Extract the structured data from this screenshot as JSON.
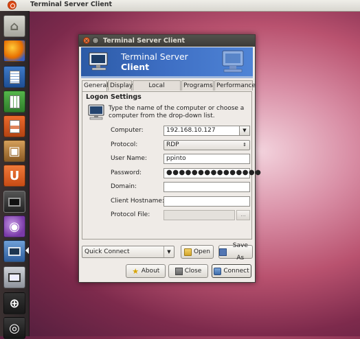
{
  "panel": {
    "title": "Terminal Server Client"
  },
  "launcher": {
    "items": [
      "home-folder",
      "firefox",
      "writer",
      "calc",
      "impress",
      "software-centre",
      "ubuntu-one",
      "terminal",
      "network",
      "terminal-server-client",
      "workspace-switcher",
      "magnifier",
      "eye"
    ]
  },
  "dialog": {
    "title": "Terminal Server Client",
    "banner_line1": "Terminal Server",
    "banner_line2": "Client",
    "tabs": [
      "General",
      "Display",
      "Local Resources",
      "Programs",
      "Performance"
    ],
    "section_title": "Logon Settings",
    "section_desc": "Type the name of the computer or choose a computer from the drop-down list.",
    "fields": {
      "computer": {
        "label": "Computer:",
        "value": "192.168.10.127"
      },
      "protocol": {
        "label": "Protocol:",
        "value": "RDP"
      },
      "username": {
        "label": "User Name:",
        "value": "ppinto"
      },
      "password": {
        "label": "Password:",
        "value": "●●●●●●●●●●●●●●●"
      },
      "domain": {
        "label": "Domain:",
        "value": ""
      },
      "hostname": {
        "label": "Client Hostname:",
        "value": ""
      },
      "protocol_file": {
        "label": "Protocol File:",
        "value": "",
        "browse": "..."
      }
    },
    "quick_connect": "Quick Connect",
    "buttons": {
      "open": "Open",
      "save_as": "Save As",
      "about": "About",
      "close": "Close",
      "connect": "Connect"
    }
  },
  "colors": {
    "banner": "#3e6fc4",
    "accent": "#dd4814",
    "desktop": "#b9526f"
  }
}
